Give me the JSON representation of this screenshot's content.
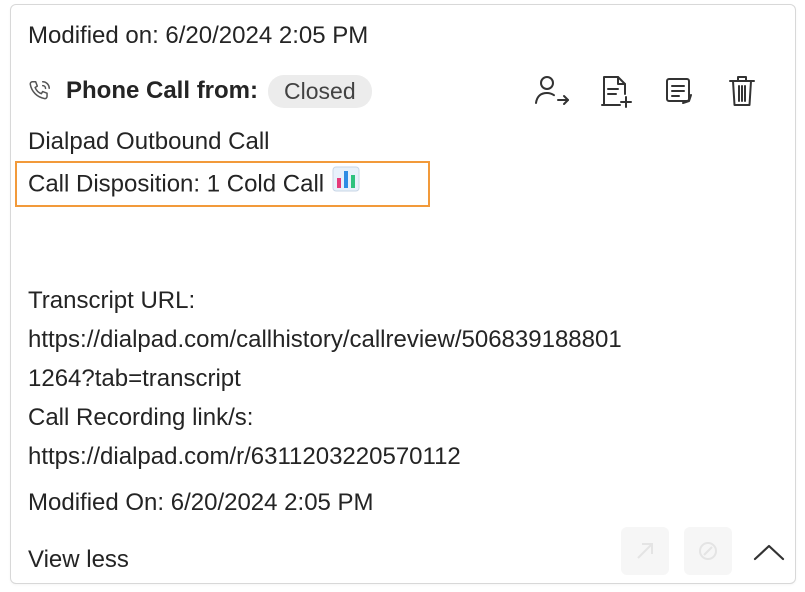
{
  "activity": {
    "modified_top": "Modified on: 6/20/2024 2:05 PM",
    "header_title": "Phone Call from:",
    "status": "Closed",
    "subject": "Dialpad Outbound Call",
    "disposition": "Call Disposition: 1 Cold Call",
    "transcript_label": "Transcript URL:",
    "transcript_url_line1": "https://dialpad.com/callhistory/callreview/506839188801",
    "transcript_url_line2": "1264?tab=transcript",
    "recording_label": "Call Recording link/s:",
    "recording_url": "https://dialpad.com/r/6311203220570112",
    "modified_bottom": "Modified On: 6/20/2024 2:05 PM",
    "view_less": "View less"
  },
  "icons": {
    "phone": "phone-call-icon",
    "assign": "assign-user-icon",
    "add_note": "add-note-icon",
    "open_record": "open-record-icon",
    "delete": "delete-icon",
    "chart_emoji": "bar-chart-emoji-icon",
    "collapse": "chevron-up-icon"
  },
  "colors": {
    "highlight_border": "#f29a3a",
    "badge_bg": "#ececec",
    "text": "#242424"
  }
}
